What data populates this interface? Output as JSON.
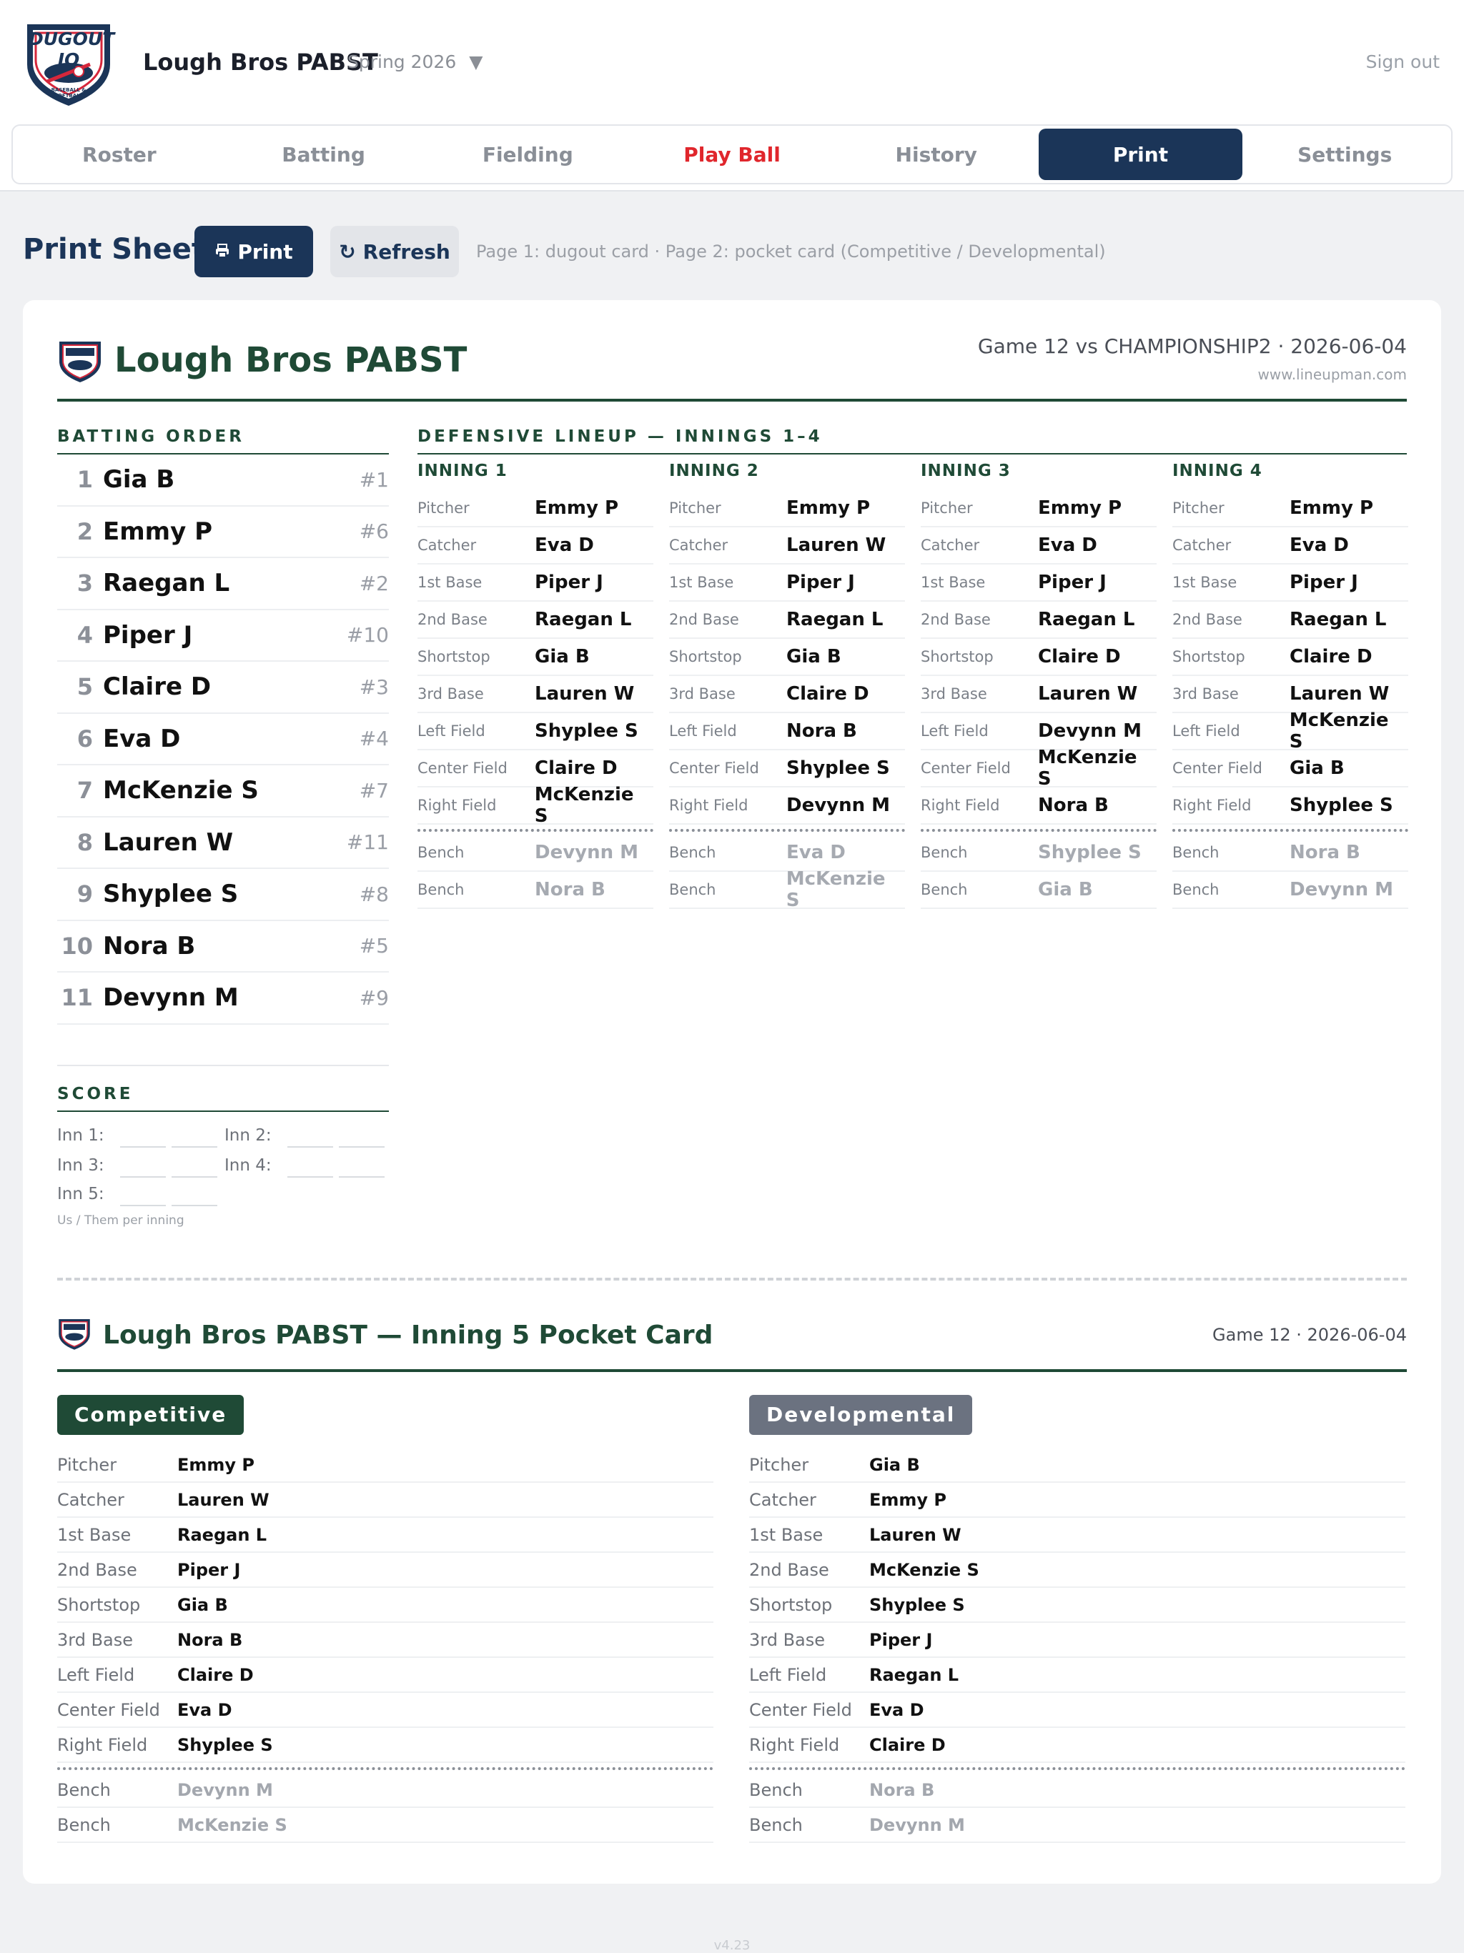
{
  "header": {
    "logo_text": "DUGOUT IQ",
    "logo_sub": "BASEBALL & SOFTBALL",
    "team": "Lough Bros PABST",
    "season": "Spring 2026",
    "signout": "Sign out"
  },
  "tabs": [
    "Roster",
    "Batting",
    "Fielding",
    "Play Ball",
    "History",
    "Print",
    "Settings"
  ],
  "printbar": {
    "title": "Print Sheet",
    "print_label": "Print",
    "refresh_label": "Refresh",
    "note": "Page 1: dugout card · Page 2: pocket card (Competitive / Developmental)"
  },
  "sheet": {
    "title": "Lough Bros PABST",
    "game": "Game 12 vs CHAMPIONSHIP2 · 2026-06-04",
    "site": "www.lineupman.com",
    "batting_label": "BATTING ORDER",
    "defense_label": "DEFENSIVE LINEUP — INNINGS 1–4",
    "batting": [
      {
        "num": "1",
        "name": "Gia B",
        "jersey": "#1"
      },
      {
        "num": "2",
        "name": "Emmy P",
        "jersey": "#6"
      },
      {
        "num": "3",
        "name": "Raegan L",
        "jersey": "#2"
      },
      {
        "num": "4",
        "name": "Piper J",
        "jersey": "#10"
      },
      {
        "num": "5",
        "name": "Claire D",
        "jersey": "#3"
      },
      {
        "num": "6",
        "name": "Eva D",
        "jersey": "#4"
      },
      {
        "num": "7",
        "name": "McKenzie S",
        "jersey": "#7"
      },
      {
        "num": "8",
        "name": "Lauren W",
        "jersey": "#11"
      },
      {
        "num": "9",
        "name": "Shyplee S",
        "jersey": "#8"
      },
      {
        "num": "10",
        "name": "Nora B",
        "jersey": "#5"
      },
      {
        "num": "11",
        "name": "Devynn M",
        "jersey": "#9"
      }
    ],
    "score_label": "SCORE",
    "score": {
      "inn1": "Inn 1:",
      "inn2": "Inn 2:",
      "inn3": "Inn 3:",
      "inn4": "Inn 4:",
      "inn5": "Inn 5:",
      "note": "Us / Them per inning"
    },
    "innings": [
      {
        "title": "INNING 1",
        "positions": [
          {
            "pos": "Pitcher",
            "player": "Emmy P"
          },
          {
            "pos": "Catcher",
            "player": "Eva D"
          },
          {
            "pos": "1st Base",
            "player": "Piper J"
          },
          {
            "pos": "2nd Base",
            "player": "Raegan L"
          },
          {
            "pos": "Shortstop",
            "player": "Gia B"
          },
          {
            "pos": "3rd Base",
            "player": "Lauren W"
          },
          {
            "pos": "Left Field",
            "player": "Shyplee S"
          },
          {
            "pos": "Center Field",
            "player": "Claire D"
          },
          {
            "pos": "Right Field",
            "player": "McKenzie S"
          }
        ],
        "bench": [
          {
            "pos": "Bench",
            "player": "Devynn M"
          },
          {
            "pos": "Bench",
            "player": "Nora B"
          }
        ]
      },
      {
        "title": "INNING 2",
        "positions": [
          {
            "pos": "Pitcher",
            "player": "Emmy P"
          },
          {
            "pos": "Catcher",
            "player": "Lauren W"
          },
          {
            "pos": "1st Base",
            "player": "Piper J"
          },
          {
            "pos": "2nd Base",
            "player": "Raegan L"
          },
          {
            "pos": "Shortstop",
            "player": "Gia B"
          },
          {
            "pos": "3rd Base",
            "player": "Claire D"
          },
          {
            "pos": "Left Field",
            "player": "Nora B"
          },
          {
            "pos": "Center Field",
            "player": "Shyplee S"
          },
          {
            "pos": "Right Field",
            "player": "Devynn M"
          }
        ],
        "bench": [
          {
            "pos": "Bench",
            "player": "Eva D"
          },
          {
            "pos": "Bench",
            "player": "McKenzie S"
          }
        ]
      },
      {
        "title": "INNING 3",
        "positions": [
          {
            "pos": "Pitcher",
            "player": "Emmy P"
          },
          {
            "pos": "Catcher",
            "player": "Eva D"
          },
          {
            "pos": "1st Base",
            "player": "Piper J"
          },
          {
            "pos": "2nd Base",
            "player": "Raegan L"
          },
          {
            "pos": "Shortstop",
            "player": "Claire D"
          },
          {
            "pos": "3rd Base",
            "player": "Lauren W"
          },
          {
            "pos": "Left Field",
            "player": "Devynn M"
          },
          {
            "pos": "Center Field",
            "player": "McKenzie S"
          },
          {
            "pos": "Right Field",
            "player": "Nora B"
          }
        ],
        "bench": [
          {
            "pos": "Bench",
            "player": "Shyplee S"
          },
          {
            "pos": "Bench",
            "player": "Gia B"
          }
        ]
      },
      {
        "title": "INNING 4",
        "positions": [
          {
            "pos": "Pitcher",
            "player": "Emmy P"
          },
          {
            "pos": "Catcher",
            "player": "Eva D"
          },
          {
            "pos": "1st Base",
            "player": "Piper J"
          },
          {
            "pos": "2nd Base",
            "player": "Raegan L"
          },
          {
            "pos": "Shortstop",
            "player": "Claire D"
          },
          {
            "pos": "3rd Base",
            "player": "Lauren W"
          },
          {
            "pos": "Left Field",
            "player": "McKenzie S"
          },
          {
            "pos": "Center Field",
            "player": "Gia B"
          },
          {
            "pos": "Right Field",
            "player": "Shyplee S"
          }
        ],
        "bench": [
          {
            "pos": "Bench",
            "player": "Nora B"
          },
          {
            "pos": "Bench",
            "player": "Devynn M"
          }
        ]
      }
    ]
  },
  "pocket": {
    "title": "Lough Bros PABST — Inning 5 Pocket Card",
    "game": "Game 12 · 2026-06-04",
    "competitive": {
      "label": "Competitive",
      "positions": [
        {
          "pos": "Pitcher",
          "player": "Emmy P"
        },
        {
          "pos": "Catcher",
          "player": "Lauren W"
        },
        {
          "pos": "1st Base",
          "player": "Raegan L"
        },
        {
          "pos": "2nd Base",
          "player": "Piper J"
        },
        {
          "pos": "Shortstop",
          "player": "Gia B"
        },
        {
          "pos": "3rd Base",
          "player": "Nora B"
        },
        {
          "pos": "Left Field",
          "player": "Claire D"
        },
        {
          "pos": "Center Field",
          "player": "Eva D"
        },
        {
          "pos": "Right Field",
          "player": "Shyplee S"
        }
      ],
      "bench": [
        {
          "pos": "Bench",
          "player": "Devynn M"
        },
        {
          "pos": "Bench",
          "player": "McKenzie S"
        }
      ]
    },
    "developmental": {
      "label": "Developmental",
      "positions": [
        {
          "pos": "Pitcher",
          "player": "Gia B"
        },
        {
          "pos": "Catcher",
          "player": "Emmy P"
        },
        {
          "pos": "1st Base",
          "player": "Lauren W"
        },
        {
          "pos": "2nd Base",
          "player": "McKenzie S"
        },
        {
          "pos": "Shortstop",
          "player": "Shyplee S"
        },
        {
          "pos": "3rd Base",
          "player": "Piper J"
        },
        {
          "pos": "Left Field",
          "player": "Raegan L"
        },
        {
          "pos": "Center Field",
          "player": "Eva D"
        },
        {
          "pos": "Right Field",
          "player": "Claire D"
        }
      ],
      "bench": [
        {
          "pos": "Bench",
          "player": "Nora B"
        },
        {
          "pos": "Bench",
          "player": "Devynn M"
        }
      ]
    }
  },
  "footer": {
    "version": "v4.23"
  },
  "colors": {
    "navy": "#1b3558",
    "green": "#1f4a36",
    "red": "#e0262c",
    "grey_badge": "#6b7280"
  }
}
